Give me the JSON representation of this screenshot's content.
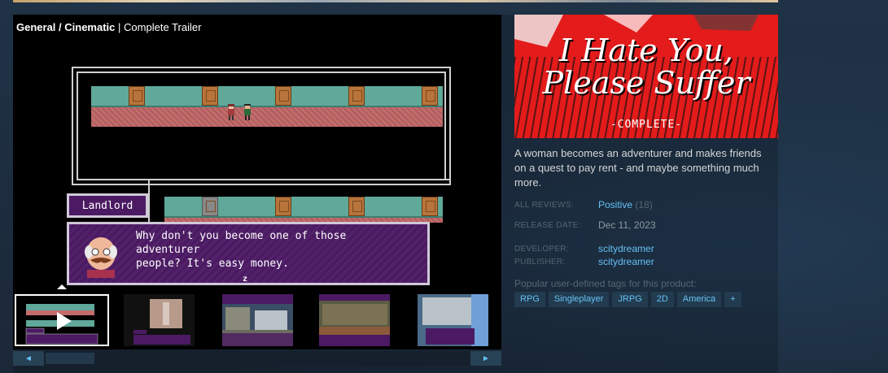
{
  "video": {
    "category": "General / Cinematic",
    "separator": "|",
    "title": "Complete Trailer"
  },
  "game": {
    "speaker": "Landlord",
    "dialog_line1": "Why don't you become one of those adventurer",
    "dialog_line2": "people? It's easy money.",
    "advance": "z"
  },
  "capsule": {
    "line1": "I Hate You,",
    "line2": "Please Suffer",
    "line3": "-COMPLETE-"
  },
  "description": "A woman becomes an adventurer and makes friends on a quest to pay rent - and maybe something much more.",
  "reviews": {
    "label": "ALL REVIEWS:",
    "summary": "Positive",
    "count": "(18)"
  },
  "release": {
    "label": "RELEASE DATE:",
    "date": "Dec 11, 2023"
  },
  "developer": {
    "label": "DEVELOPER:",
    "name": "scitydreamer"
  },
  "publisher": {
    "label": "PUBLISHER:",
    "name": "scitydreamer"
  },
  "tags": {
    "heading": "Popular user-defined tags for this product:",
    "items": [
      "RPG",
      "Singleplayer",
      "JRPG",
      "2D",
      "America",
      "+"
    ]
  },
  "nav": {
    "prev": "◄",
    "next": "►"
  },
  "colors": {
    "accent": "#66c0f4",
    "background": "#1b2838",
    "tag_bg": "#223b4f",
    "capsule_red": "#e31b1b"
  }
}
